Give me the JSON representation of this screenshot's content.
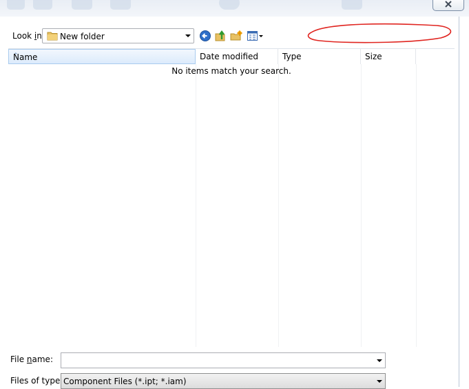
{
  "look_in": {
    "label_pre": "Look ",
    "label_key": "i",
    "label_post": "n:",
    "value": "New folder"
  },
  "columns": [
    "Name",
    "Date modified",
    "Type",
    "Size"
  ],
  "empty_message": "No items match your search.",
  "file_name": {
    "label_pre": "File ",
    "label_key": "n",
    "label_post": "ame:",
    "value": ""
  },
  "files_of_type": {
    "label": "Files of type:",
    "value": "Component Files (*.ipt; *.iam)"
  },
  "colors": {
    "annotation": "#e0241f",
    "header_hover": "#dcebfc"
  },
  "icons": [
    "close-icon",
    "folder-icon",
    "back-icon",
    "up-folder-icon",
    "new-folder-icon",
    "views-menu-icon"
  ]
}
